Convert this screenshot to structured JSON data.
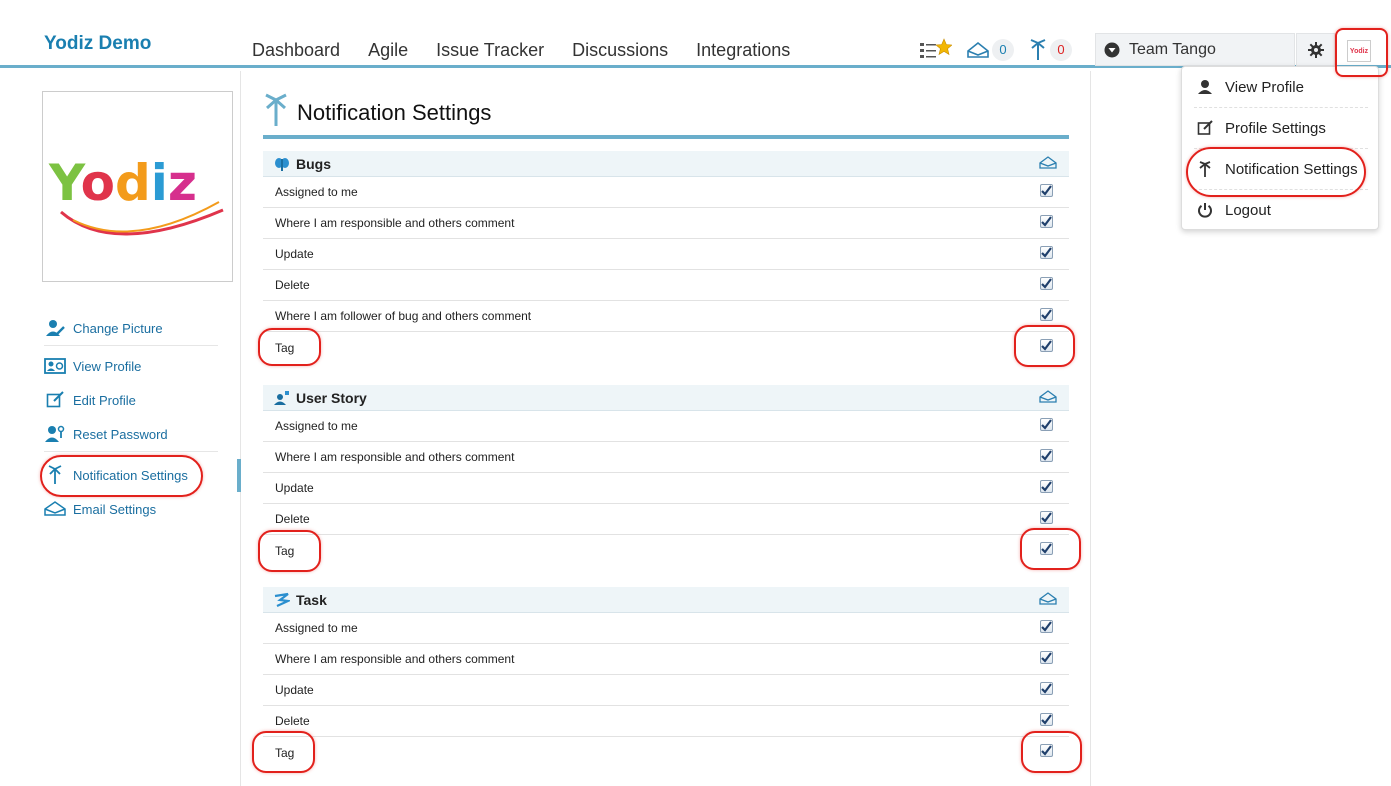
{
  "app": {
    "brand": "Yodiz Demo"
  },
  "nav": [
    "Dashboard",
    "Agile",
    "Issue Tracker",
    "Discussions",
    "Integrations"
  ],
  "top_icons": {
    "favorites_icon": "favorites-icon",
    "messages_count": "0",
    "notifications_count": "0"
  },
  "team": {
    "label": "Team Tango"
  },
  "user_menu": {
    "items": [
      {
        "label": "View Profile",
        "icon": "user-icon"
      },
      {
        "label": "Profile Settings",
        "icon": "edit-icon"
      },
      {
        "label": "Notification Settings",
        "icon": "notification-icon"
      },
      {
        "label": "Logout",
        "icon": "power-icon"
      }
    ]
  },
  "sidebar": {
    "logo_text": "Yodiz",
    "items": [
      {
        "label": "Change Picture",
        "icon": "change-picture-icon"
      },
      {
        "label": "View Profile",
        "icon": "view-profile-icon"
      },
      {
        "label": "Edit Profile",
        "icon": "edit-profile-icon"
      },
      {
        "label": "Reset Password",
        "icon": "reset-password-icon"
      },
      {
        "label": "Notification Settings",
        "icon": "notification-icon"
      },
      {
        "label": "Email Settings",
        "icon": "email-icon"
      }
    ]
  },
  "main": {
    "title": "Notification Settings",
    "sections": [
      {
        "title": "Bugs",
        "icon": "bug-icon",
        "rows": [
          {
            "label": "Assigned to me",
            "checked": true
          },
          {
            "label": "Where I am responsible and others comment",
            "checked": true
          },
          {
            "label": "Update",
            "checked": true
          },
          {
            "label": "Delete",
            "checked": true
          },
          {
            "label": "Where I am follower of bug and others comment",
            "checked": true
          },
          {
            "label": "Tag",
            "checked": true
          }
        ]
      },
      {
        "title": "User Story",
        "icon": "user-story-icon",
        "rows": [
          {
            "label": "Assigned to me",
            "checked": true
          },
          {
            "label": "Where I am responsible and others comment",
            "checked": true
          },
          {
            "label": "Update",
            "checked": true
          },
          {
            "label": "Delete",
            "checked": true
          },
          {
            "label": "Tag",
            "checked": true
          }
        ]
      },
      {
        "title": "Task",
        "icon": "task-icon",
        "rows": [
          {
            "label": "Assigned to me",
            "checked": true
          },
          {
            "label": "Where I am responsible and others comment",
            "checked": true
          },
          {
            "label": "Update",
            "checked": true
          },
          {
            "label": "Delete",
            "checked": true
          },
          {
            "label": "Tag",
            "checked": true
          }
        ]
      }
    ]
  },
  "colors": {
    "accent": "#6aaecb",
    "brand": "#1a7fb0",
    "link": "#1a6ea0",
    "highlight": "#e2211c"
  }
}
